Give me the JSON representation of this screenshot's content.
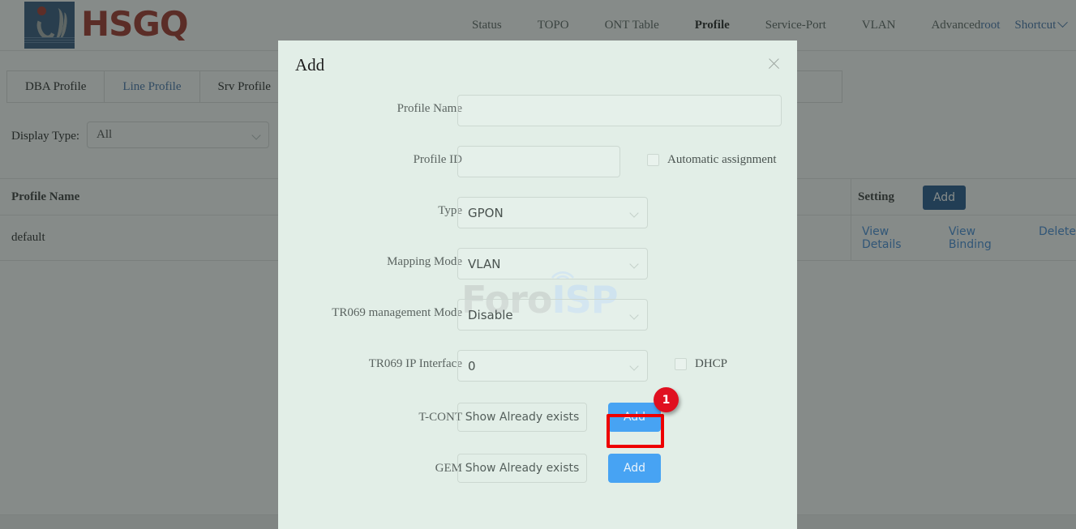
{
  "brand": {
    "name": "HSGQ",
    "logo_icon": "hsgq-logo-icon"
  },
  "nav": {
    "items": [
      {
        "label": "Status",
        "active": false
      },
      {
        "label": "TOPO",
        "active": false
      },
      {
        "label": "ONT Table",
        "active": false
      },
      {
        "label": "Profile",
        "active": true
      },
      {
        "label": "Service-Port",
        "active": false
      },
      {
        "label": "VLAN",
        "active": false
      },
      {
        "label": "Advanced",
        "active": false
      }
    ],
    "user": "root",
    "shortcut": "Shortcut",
    "shortcut_icon": "chevron-down-icon"
  },
  "tabs": [
    {
      "label": "DBA Profile",
      "active": false
    },
    {
      "label": "Line Profile",
      "active": true
    },
    {
      "label": "Srv Profile",
      "active": false
    }
  ],
  "filter": {
    "label": "Display Type:",
    "value": "All",
    "arrow_icon": "chevron-down-icon"
  },
  "table": {
    "columns": [
      "Profile Name",
      "Setting"
    ],
    "header_add_label": "Add",
    "rows": [
      {
        "profile_name": "default",
        "actions": [
          "View Details",
          "View Binding",
          "Delete"
        ]
      }
    ]
  },
  "watermark": {
    "part1": "Foro",
    "part2": "ISP",
    "icon": "signal-antenna-icon"
  },
  "modal": {
    "title": "Add",
    "close_icon": "close-icon",
    "fields": {
      "profile_name": {
        "label": "Profile Name",
        "value": "",
        "placeholder": ""
      },
      "profile_id": {
        "label": "Profile ID",
        "value": "",
        "placeholder": ""
      },
      "automatic_assignment": {
        "label": "Automatic assignment",
        "checked": false
      },
      "type": {
        "label": "Type",
        "value": "GPON",
        "arrow_icon": "chevron-down-icon"
      },
      "mapping_mode": {
        "label": "Mapping Mode",
        "value": "VLAN",
        "arrow_icon": "chevron-down-icon"
      },
      "tr069_management_mode": {
        "label": "TR069 management Mode",
        "value": "Disable",
        "arrow_icon": "chevron-down-icon"
      },
      "tr069_ip_interface": {
        "label": "TR069 IP Interface",
        "value": "0",
        "arrow_icon": "chevron-down-icon"
      },
      "dhcp": {
        "label": "DHCP",
        "checked": false
      },
      "tcont": {
        "label": "T-CONT",
        "show_label": "Show Already exists",
        "add_label": "Add"
      },
      "gem": {
        "label": "GEM",
        "show_label": "Show Already exists",
        "add_label": "Add"
      }
    }
  },
  "annotation": {
    "step_number": "1",
    "highlight_color": "#ee0000",
    "badge_color": "#e01020"
  }
}
